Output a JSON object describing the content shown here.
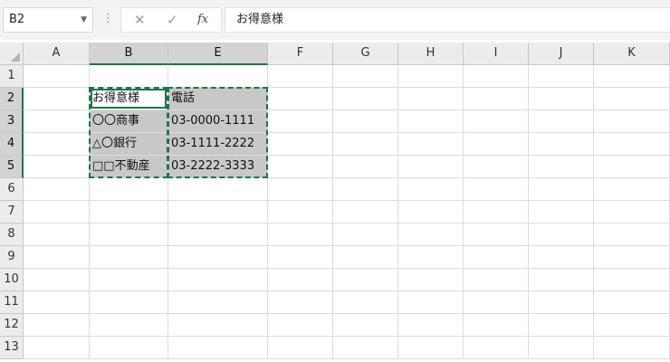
{
  "formula_bar": {
    "name_box": "B2",
    "cancel_icon": "✕",
    "enter_icon": "✓",
    "fx_label": "fx",
    "content": "お得意様"
  },
  "columns": [
    "A",
    "B",
    "E",
    "F",
    "G",
    "H",
    "I",
    "J",
    "K"
  ],
  "rows": [
    "1",
    "2",
    "3",
    "4",
    "5",
    "6",
    "7",
    "8",
    "9",
    "10",
    "11",
    "12",
    "13"
  ],
  "selected_cell": "B2",
  "table": [
    [
      "お得意様",
      "電話"
    ],
    [
      "〇〇商事",
      "03-0000-1111"
    ],
    [
      "△〇銀行",
      "03-1111-2222"
    ],
    [
      "□□不動産",
      "03-2222-3333"
    ]
  ],
  "colors": {
    "accent": "#217346",
    "cell_fill": "#c8c8c8"
  }
}
